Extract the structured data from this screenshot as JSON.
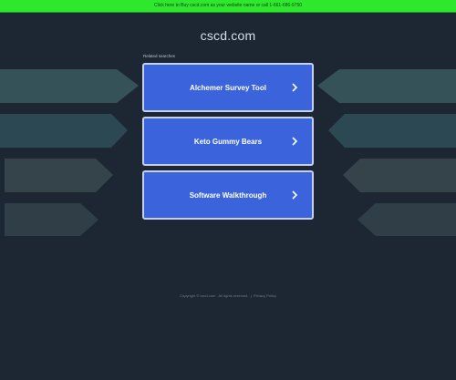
{
  "banner": {
    "text": "Click here to Buy cscd.com as your website name or call 1-661-686-9750"
  },
  "site": {
    "domain": "cscd.com"
  },
  "related": {
    "label": "Related searches",
    "items": [
      {
        "label": "Alchemer Survey Tool"
      },
      {
        "label": "Keto Gummy Bears"
      },
      {
        "label": "Software Walkthrough"
      }
    ]
  },
  "footer": {
    "copyright": "Copyright © cscd.com . All rights reserved.",
    "separator": "|",
    "privacy": "Privacy Policy"
  },
  "colors": {
    "background": "#1c2733",
    "banner": "#2ee82e",
    "link_box": "#3b64dc",
    "link_border": "#c6d1f2",
    "decor_shapes": "#2f4a52"
  }
}
